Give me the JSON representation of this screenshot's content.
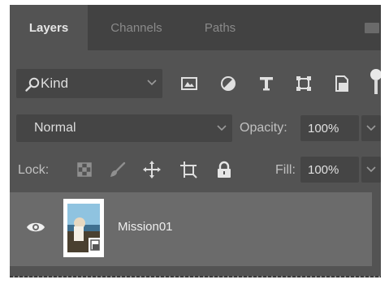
{
  "tabs": [
    {
      "label": "Layers",
      "active": true
    },
    {
      "label": "Channels",
      "active": false
    },
    {
      "label": "Paths",
      "active": false
    }
  ],
  "filter": {
    "kind_label": "Kind",
    "icons": [
      "image-filter-icon",
      "adjustment-filter-icon",
      "type-filter-icon",
      "shape-filter-icon",
      "smart-object-filter-icon"
    ]
  },
  "blend": {
    "mode": "Normal",
    "opacity_label": "Opacity:",
    "opacity_value": "100%"
  },
  "lock": {
    "label": "Lock:",
    "icons": [
      "lock-transparent-pixels-icon",
      "lock-image-pixels-icon",
      "lock-position-icon",
      "artboard-lock-icon",
      "lock-all-icon"
    ],
    "fill_label": "Fill:",
    "fill_value": "100%"
  },
  "layers": [
    {
      "name": "Mission01",
      "visible": true,
      "smart_object": true
    }
  ],
  "colors": {
    "panel_bg": "#535353",
    "tabbar_bg": "#424242",
    "field_bg": "#454545",
    "selected_layer_bg": "#6b6b6b",
    "text": "#e6e6e6"
  }
}
